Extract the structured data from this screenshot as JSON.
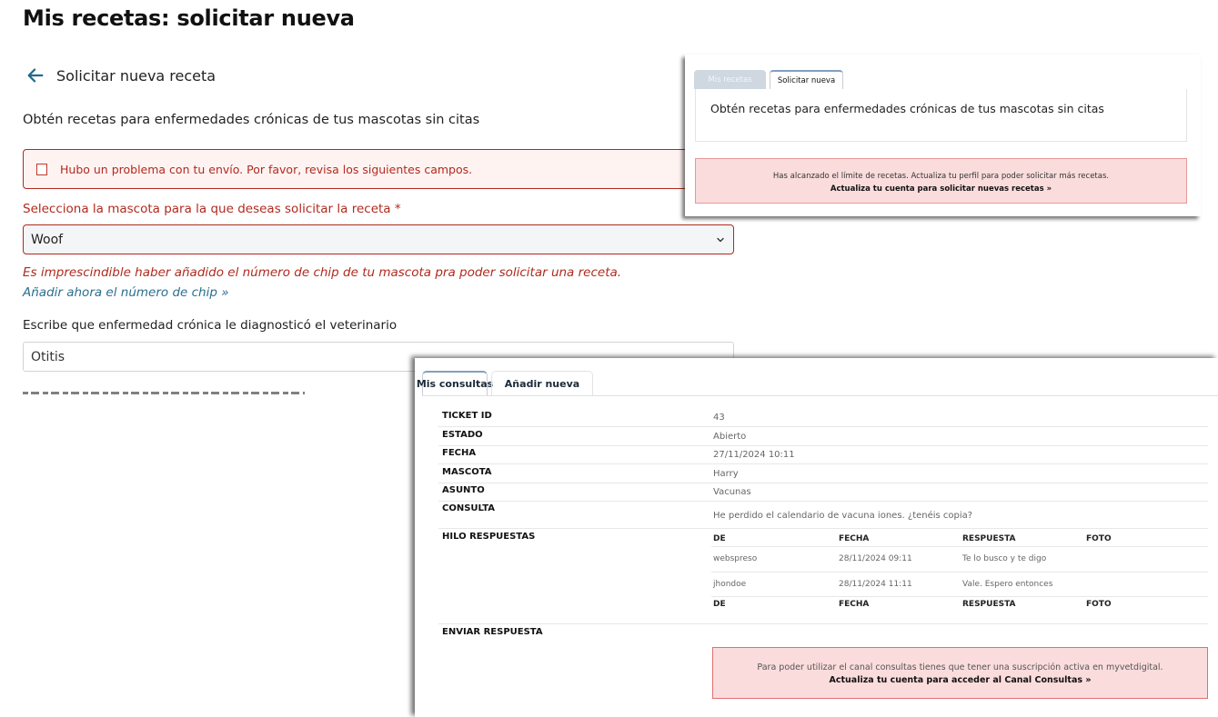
{
  "page": {
    "title": "Mis recetas: solicitar nueva",
    "back_label": "Solicitar nueva receta",
    "intro": "Obtén recetas para enfermedades crónicas de tus mascotas sin citas",
    "error_message": "Hubo un problema con tu envío. Por favor, revisa los siguientes campos.",
    "pet_field": {
      "label": "Selecciona la mascota para la que deseas solicitar la receta *",
      "value": "Woof"
    },
    "chip_warning": "Es imprescindible haber añadido el número de chip de tu mascota pra poder solicitar una receta.",
    "chip_link": "Añadir ahora el número de chip »",
    "disease_field": {
      "label": "Escribe que enfermedad crónica le diagnosticó el veterinario",
      "value": "Otitis"
    }
  },
  "recetas_panel": {
    "tabs": [
      "Mis recetas",
      "Solicitar nueva"
    ],
    "active_tab": "Solicitar nueva",
    "intro": "Obtén recetas para enfermedades crónicas de tus mascotas sin citas",
    "limit_message": "Has alcanzado el límite de recetas. Actualiza tu perfil para poder solicitar más recetas.",
    "limit_link": "Actualiza tu cuenta para solicitar nuevas recetas »"
  },
  "consultas_panel": {
    "tabs": [
      "Mis consultas",
      "Añadir nueva"
    ],
    "active_tab": "Mis consultas",
    "fields": [
      {
        "label": "TICKET ID",
        "value": "43"
      },
      {
        "label": "ESTADO",
        "value": "Abierto"
      },
      {
        "label": "FECHA",
        "value": "27/11/2024 10:11"
      },
      {
        "label": "MASCOTA",
        "value": "Harry"
      },
      {
        "label": "ASUNTO",
        "value": "Vacunas"
      },
      {
        "label": "CONSULTA",
        "value": "He perdido el calendario de vacuna iones. ¿tenéis copia?"
      }
    ],
    "thread_label": "HILO RESPUESTAS",
    "thread_headers": [
      "DE",
      "FECHA",
      "RESPUESTA",
      "FOTO"
    ],
    "thread_rows": [
      {
        "de": "webspreso",
        "fecha": "28/11/2024 09:11",
        "respuesta": "Te lo busco y te digo",
        "foto": ""
      },
      {
        "de": "jhondoe",
        "fecha": "28/11/2024 11:11",
        "respuesta": "Vale. Espero entonces",
        "foto": ""
      }
    ],
    "send_label": "ENVIAR RESPUESTA",
    "subscription_message": "Para poder utilizar el canal consultas tienes que tener una suscripción activa en myvetdigital.",
    "subscription_link": "Actualiza tu cuenta para acceder al Canal Consultas »"
  },
  "icons": {
    "back": "arrow-left-icon",
    "error": "checkbox-icon",
    "dropdown": "chevron-down-icon"
  },
  "colors": {
    "error": "#b02a1e",
    "link": "#2a6f8f",
    "alert_bg": "#fbdcdc",
    "tab_accent": "#7fa0bf"
  }
}
